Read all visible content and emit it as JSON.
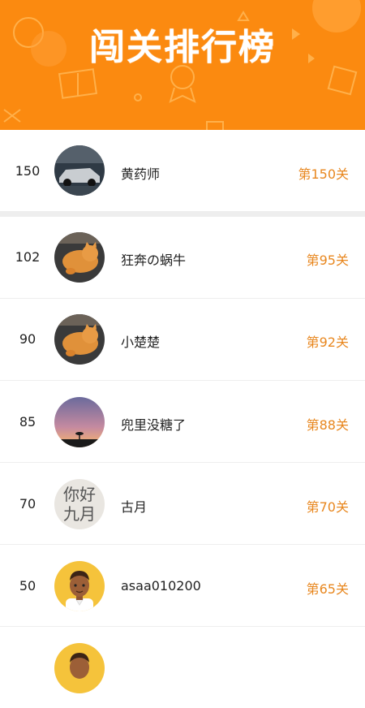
{
  "header": {
    "title": "闯关排行榜"
  },
  "my_entry": {
    "rank": "150",
    "name": "黄药师",
    "level": "第150关",
    "avatar": "car-photo-avatar"
  },
  "leaderboard": [
    {
      "rank": "102",
      "name": "狂奔の蜗牛",
      "level": "第95关",
      "avatar": "cat-photo-avatar"
    },
    {
      "rank": "90",
      "name": "小楚楚",
      "level": "第92关",
      "avatar": "cat-photo-avatar"
    },
    {
      "rank": "85",
      "name": "兜里没糖了",
      "level": "第88关",
      "avatar": "sunset-photo-avatar"
    },
    {
      "rank": "70",
      "name": "古月",
      "level": "第70关",
      "avatar": "calligraphy-avatar",
      "avatar_text": "你好九月"
    },
    {
      "rank": "50",
      "name": "asaa010200",
      "level": "第65关",
      "avatar": "cartoon-man-avatar"
    }
  ],
  "colors": {
    "accent": "#fb8a10",
    "level_text": "#e8871f"
  }
}
